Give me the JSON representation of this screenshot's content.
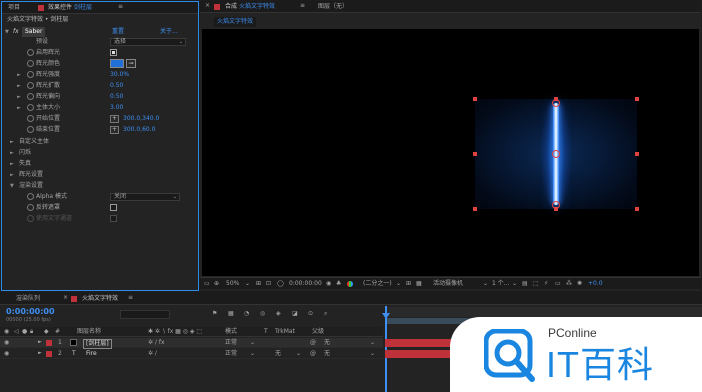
{
  "effect_controls": {
    "tab_project": "项目",
    "tab_effects_prefix": "效果控件",
    "tab_layer_name": "剑柱层",
    "breadcrumb": "火焰文字特效 • 剑柱层",
    "effect_name": "Saber",
    "reset_label": "重置",
    "about_label": "关于...",
    "props": {
      "preset": {
        "label": "预设",
        "value": "选择"
      },
      "enable_glow": {
        "label": "启用辉光"
      },
      "glow_color": {
        "label": "辉光颜色",
        "color": "#1f6fd6"
      },
      "glow_intensity": {
        "label": "辉光强度",
        "value": "30.0%"
      },
      "glow_spread": {
        "label": "辉光扩散",
        "value": "0.50"
      },
      "glow_bias": {
        "label": "辉光偏向",
        "value": "0.50"
      },
      "core_size": {
        "label": "主体大小",
        "value": "3.00"
      },
      "start_pos": {
        "label": "开始位置",
        "value": "300.0,340.0"
      },
      "end_pos": {
        "label": "结束位置",
        "value": "300.0,60.0"
      },
      "custom_core": {
        "label": "自定义主体"
      },
      "flicker": {
        "label": "闪烁"
      },
      "distortion": {
        "label": "失真"
      },
      "glow_settings": {
        "label": "辉光设置"
      },
      "render_settings": {
        "label": "渲染设置"
      },
      "alpha_mode": {
        "label": "Alpha 模式",
        "value": "关闭"
      },
      "invert_mask": {
        "label": "反转遮罩"
      },
      "use_text_alpha": {
        "label": "使用文字通道"
      }
    }
  },
  "composition": {
    "lock_icon": "lock-icon",
    "tab_prefix": "合成",
    "tab_name": "火焰文字特效",
    "layer_tab": "图层（无）",
    "sub_tab": "火焰文字特效",
    "toolbar": {
      "zoom": "50%",
      "timecode": "0:00:00:00",
      "resolution": "(二分之一)",
      "camera": "活动摄像机",
      "views": "1 个...",
      "exposure": "+0.0"
    }
  },
  "timeline": {
    "tab_render": "渲染队列",
    "tab_comp": "火焰文字特效",
    "timecode": "0:00:00:00",
    "fps": "00000 (25.00 fps)",
    "col_layer_name": "图层名称",
    "col_mode": "模式",
    "col_t": "T",
    "col_trkmat": "TrkMat",
    "col_parent": "父级",
    "layers": [
      {
        "num": "1",
        "name": "[剑柱层]",
        "mode": "正常",
        "trkmat": "",
        "parent": "无",
        "color": "#c0323a"
      },
      {
        "num": "2",
        "name": "Fire",
        "mode": "正常",
        "trkmat": "无",
        "parent": "无",
        "color": "#c0323a"
      }
    ]
  },
  "logo": {
    "brand_small": "PConline",
    "brand_big": "IT百科",
    "accent": "#1a86e0"
  }
}
